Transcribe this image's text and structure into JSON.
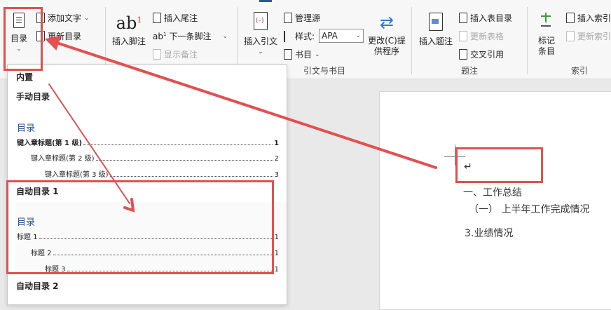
{
  "ribbon": {
    "toc_button": "目录",
    "add_text": "添加文字",
    "update_toc": "更新目录",
    "insert_footnote": "插入脚注",
    "ab_icon_text": "ab",
    "ab_superscript": "1",
    "insert_endnote": "插入尾注",
    "next_footnote": "下一条脚注",
    "show_notes": "显示备注",
    "insert_citation": "插入引文",
    "manage_sources": "管理源",
    "style_label": "样式:",
    "style_value": "APA",
    "bibliography": "书目",
    "citations_group": "引文与书目",
    "update_table_line1": "更改(C)提",
    "update_table_line2": "供程序",
    "insert_caption": "插入题注",
    "insert_table_of_figures": "插入表目录",
    "update_table": "更新表格",
    "cross_reference": "交叉引用",
    "captions_group": "题注",
    "mark_entry_line1": "标记",
    "mark_entry_line2": "条目",
    "insert_index": "插入索引",
    "update_index": "更新索引",
    "index_group": "索引"
  },
  "panel": {
    "builtin": "内置",
    "manual_toc": "手动目录",
    "toc_title": "目录",
    "manual_lines": [
      {
        "text": "键入章标题(第 1 级)",
        "page": "1"
      },
      {
        "text": "键入章标题(第 2 级)",
        "page": "2"
      },
      {
        "text": "键入章标题(第 3 级)",
        "page": "3"
      }
    ],
    "auto_toc1": "自动目录 1",
    "auto_lines": [
      {
        "text": "标题 1",
        "page": "1"
      },
      {
        "text": "标题 2",
        "page": "1"
      },
      {
        "text": "标题 3",
        "page": "1"
      }
    ],
    "auto_toc2": "自动目录 2"
  },
  "document": {
    "heading1": "一、工作总结",
    "heading2": "（一） 上半年工作完成情况",
    "heading3": "3.业绩情况",
    "para_mark": "↵"
  },
  "colors": {
    "annotation_red": "#e25050",
    "toc_blue": "#2f5496"
  }
}
